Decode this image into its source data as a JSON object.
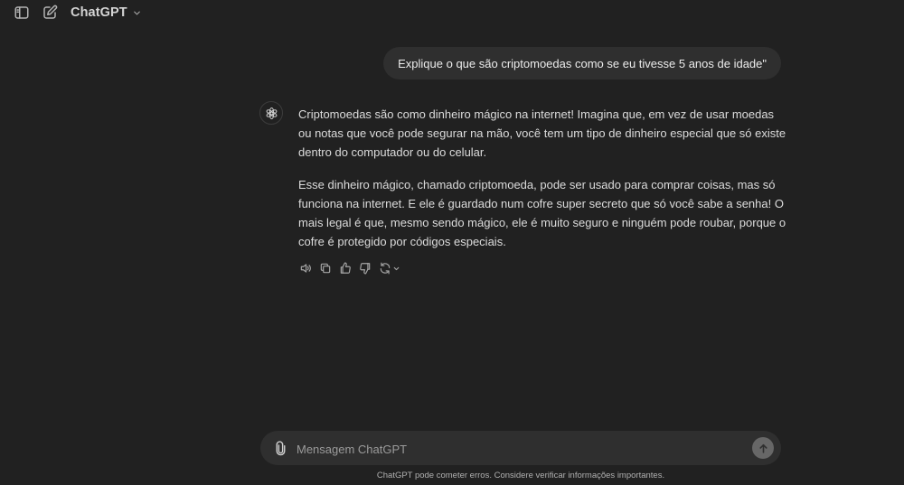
{
  "header": {
    "model_name": "ChatGPT",
    "icons": {
      "sidebar_toggle": "sidebar-icon",
      "new_chat": "edit-icon",
      "model_menu": "chevron-down-icon"
    }
  },
  "conversation": {
    "user_message": "Explique o que são criptomoedas como se eu tivesse 5 anos de idade\"",
    "assistant_paragraphs": [
      "Criptomoedas são como dinheiro mágico na internet! Imagina que, em vez de usar moedas ou notas que você pode segurar na mão, você tem um tipo de dinheiro especial que só existe dentro do computador ou do celular.",
      "Esse dinheiro mágico, chamado criptomoeda, pode ser usado para comprar coisas, mas só funciona na internet. E ele é guardado num cofre super secreto que só você sabe a senha! O mais legal é que, mesmo sendo mágico, ele é muito seguro e ninguém pode roubar, porque o cofre é protegido por códigos especiais."
    ],
    "action_icons": [
      "speaker-icon",
      "copy-icon",
      "thumbs-up-icon",
      "thumbs-down-icon",
      "regenerate-icon"
    ]
  },
  "composer": {
    "placeholder": "Mensagem ChatGPT",
    "value": ""
  },
  "footer": {
    "disclaimer": "ChatGPT pode cometer erros. Considere verificar informações importantes."
  },
  "colors": {
    "background": "#212121",
    "bubble": "#2f2f2f",
    "text": "#ececec",
    "muted": "#b4b4b4",
    "send_button": "#676767"
  }
}
